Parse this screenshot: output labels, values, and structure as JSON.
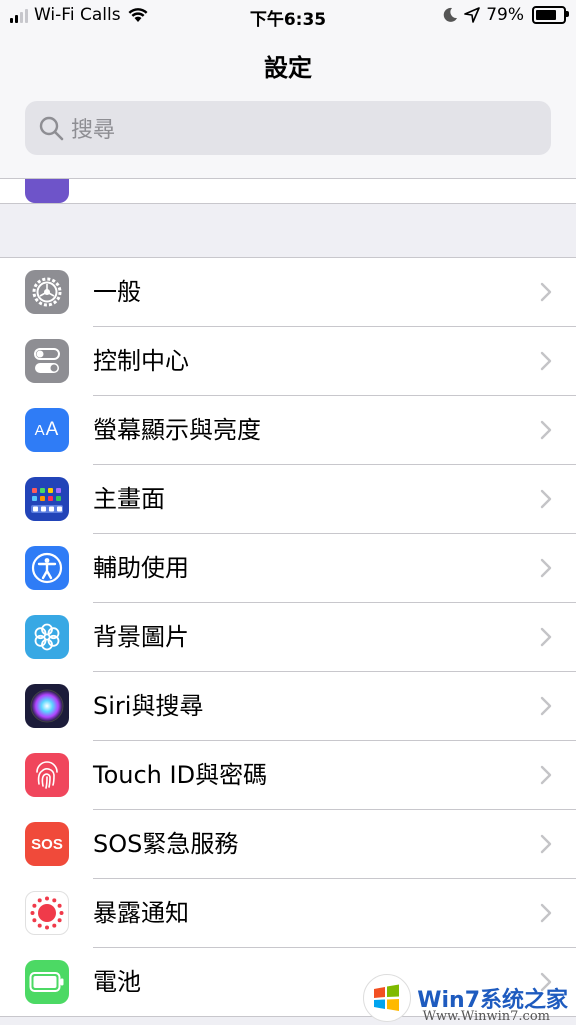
{
  "status_bar": {
    "carrier": "Wi-Fi Calls",
    "time": "下午6:35",
    "battery_percent": "79%",
    "battery_level": 0.79,
    "signal_bars_on": 2
  },
  "nav": {
    "title": "設定"
  },
  "search": {
    "placeholder": "搜尋"
  },
  "settings": {
    "items": [
      {
        "label": "一般",
        "icon": "gear-icon",
        "color": "#8e8e93"
      },
      {
        "label": "控制中心",
        "icon": "toggles-icon",
        "color": "#8e8e93"
      },
      {
        "label": "螢幕顯示與亮度",
        "icon": "text-size-icon",
        "color": "#2f7cf6"
      },
      {
        "label": "主畫面",
        "icon": "home-grid-icon",
        "color": "#2244b8"
      },
      {
        "label": "輔助使用",
        "icon": "accessibility-icon",
        "color": "#2f7cf6"
      },
      {
        "label": "背景圖片",
        "icon": "flower-icon",
        "color": "#38a8e4"
      },
      {
        "label": "Siri與搜尋",
        "icon": "siri-icon",
        "color": "#1c1c3a"
      },
      {
        "label": "Touch ID與密碼",
        "icon": "fingerprint-icon",
        "color": "#f0465c"
      },
      {
        "label": "SOS緊急服務",
        "icon": "sos-icon",
        "color": "#f04a3a"
      },
      {
        "label": "暴露通知",
        "icon": "exposure-icon",
        "color": "#ffffff"
      },
      {
        "label": "電池",
        "icon": "battery-icon",
        "color": "#4cd964"
      }
    ]
  },
  "watermark": {
    "brand": "Win7系统之家",
    "url": "Www.Winwin7.com"
  }
}
